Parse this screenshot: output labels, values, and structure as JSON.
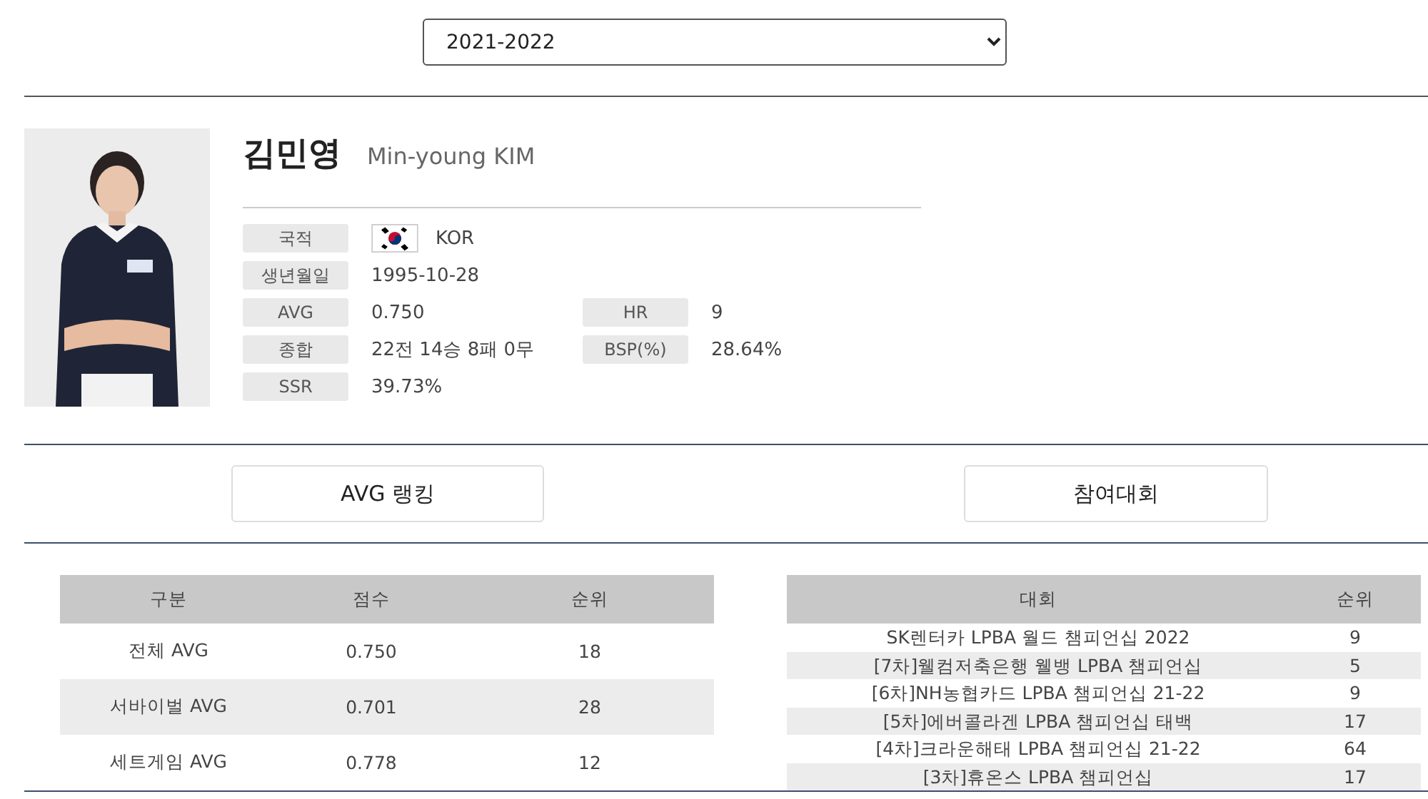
{
  "season_select": {
    "value": "2021-2022"
  },
  "player": {
    "name_ko": "김민영",
    "name_en": "Min-young KIM"
  },
  "info_rows": [
    [
      {
        "label": "국적",
        "value": "KOR",
        "kind": "nationality"
      }
    ],
    [
      {
        "label": "생년월일",
        "value": "1995-10-28",
        "kind": "plain"
      }
    ],
    [
      {
        "label": "AVG",
        "value": "0.750",
        "kind": "plain"
      },
      {
        "label": "HR",
        "value": "9",
        "kind": "plain"
      }
    ],
    [
      {
        "label": "종합",
        "value": "22전 14승 8패 0무",
        "kind": "plain"
      },
      {
        "label": "BSP(%)",
        "value": "28.64%",
        "kind": "plain"
      }
    ],
    [
      {
        "label": "SSR",
        "value": "39.73%",
        "kind": "plain"
      }
    ]
  ],
  "section_buttons": [
    {
      "label": "AVG 랭킹"
    },
    {
      "label": "참여대회"
    }
  ],
  "avg_table": {
    "columns": [
      "구분",
      "점수",
      "순위"
    ],
    "rows": [
      [
        "전체 AVG",
        "0.750",
        "18"
      ],
      [
        "서바이벌 AVG",
        "0.701",
        "28"
      ],
      [
        "세트게임 AVG",
        "0.778",
        "12"
      ]
    ]
  },
  "tournament_table": {
    "columns": [
      "대회",
      "순위"
    ],
    "rows": [
      [
        "SK렌터카 LPBA 월드 챔피언십 2022",
        "9"
      ],
      [
        "[7차]웰컴저축은행 웰뱅 LPBA 챔피언십",
        "5"
      ],
      [
        "[6차]NH농협카드 LPBA 챔피언십 21-22",
        "9"
      ],
      [
        "[5차]에버콜라겐 LPBA 챔피언십 태백",
        "17"
      ],
      [
        "[4차]크라운해태 LPBA 챔피언십 21-22",
        "64"
      ],
      [
        "[3차]휴온스 LPBA 챔피언십",
        "17"
      ]
    ]
  }
}
